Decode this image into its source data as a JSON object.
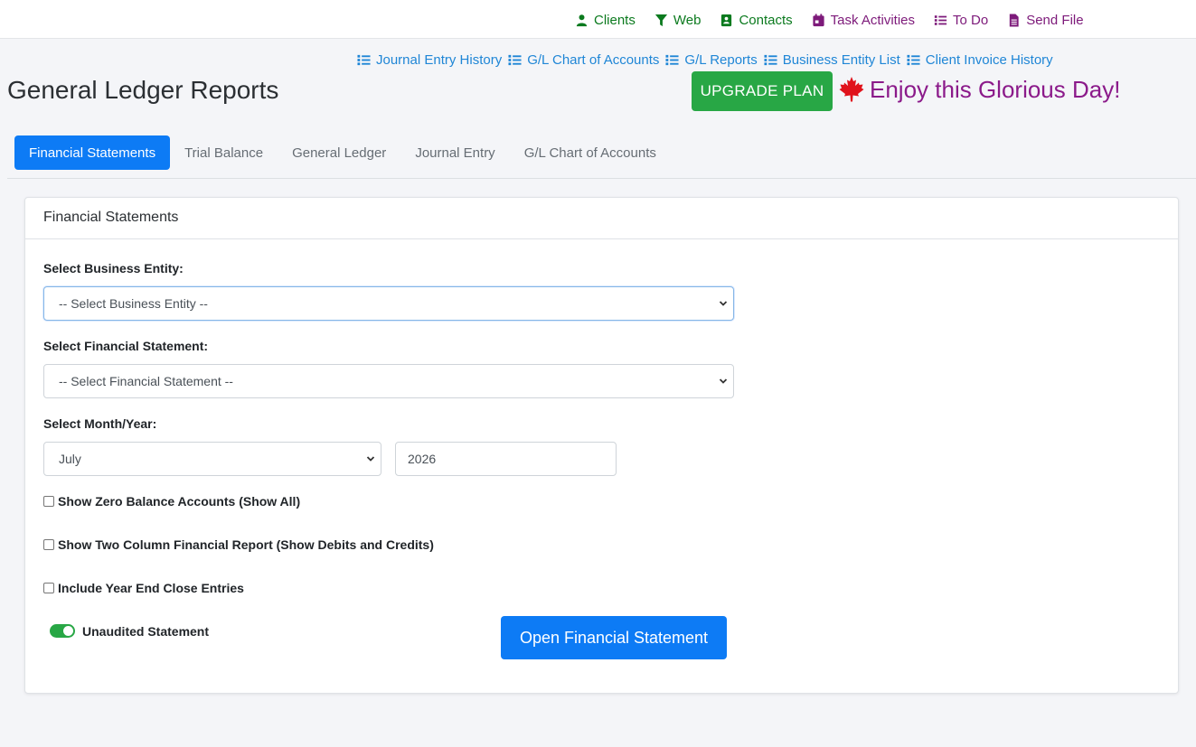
{
  "top_nav": [
    {
      "label": "Clients",
      "icon": "user-icon",
      "color": "#0b7a1e"
    },
    {
      "label": "Web",
      "icon": "filter-icon",
      "color": "#0b7a1e"
    },
    {
      "label": "Contacts",
      "icon": "contact-card-icon",
      "color": "#0b7a1e"
    },
    {
      "label": "Task Activities",
      "icon": "calendar-icon",
      "color": "#7d1a7a"
    },
    {
      "label": "To Do",
      "icon": "list-icon",
      "color": "#7d1a7a"
    },
    {
      "label": "Send File",
      "icon": "file-icon",
      "color": "#7d1a7a"
    }
  ],
  "sub_links": [
    {
      "label": "Journal Entry History"
    },
    {
      "label": "G/L Chart of Accounts"
    },
    {
      "label": "G/L Reports"
    },
    {
      "label": "Business Entity List"
    },
    {
      "label": "Client Invoice History"
    }
  ],
  "page_title": "General Ledger Reports",
  "upgrade_label": "UPGRADE PLAN",
  "greeting": "Enjoy this Glorious Day!",
  "tabs": [
    {
      "label": "Financial Statements",
      "active": true
    },
    {
      "label": "Trial Balance",
      "active": false
    },
    {
      "label": "General Ledger",
      "active": false
    },
    {
      "label": "Journal Entry",
      "active": false
    },
    {
      "label": "G/L Chart of Accounts",
      "active": false
    }
  ],
  "card": {
    "header": "Financial Statements",
    "entity_label": "Select Business Entity:",
    "entity_value": "-- Select Business Entity --",
    "statement_label": "Select Financial Statement:",
    "statement_value": "-- Select Financial Statement --",
    "month_year_label": "Select Month/Year:",
    "month_value": "July",
    "year_value": "2026",
    "checks": [
      {
        "label": "Show Zero Balance Accounts (Show All)",
        "checked": false
      },
      {
        "label": "Show Two Column Financial Report (Show Debits and Credits)",
        "checked": false
      },
      {
        "label": "Include Year End Close Entries",
        "checked": false
      }
    ],
    "toggle_label": "Unaudited Statement",
    "toggle_on": true,
    "open_button": "Open Financial Statement"
  },
  "colors": {
    "primary": "#0d7bf5",
    "success": "#28a745",
    "nav_green": "#0b7a1e",
    "nav_purple": "#7d1a7a",
    "link_blue": "#1f86d6",
    "maple_red": "#e0121b"
  }
}
